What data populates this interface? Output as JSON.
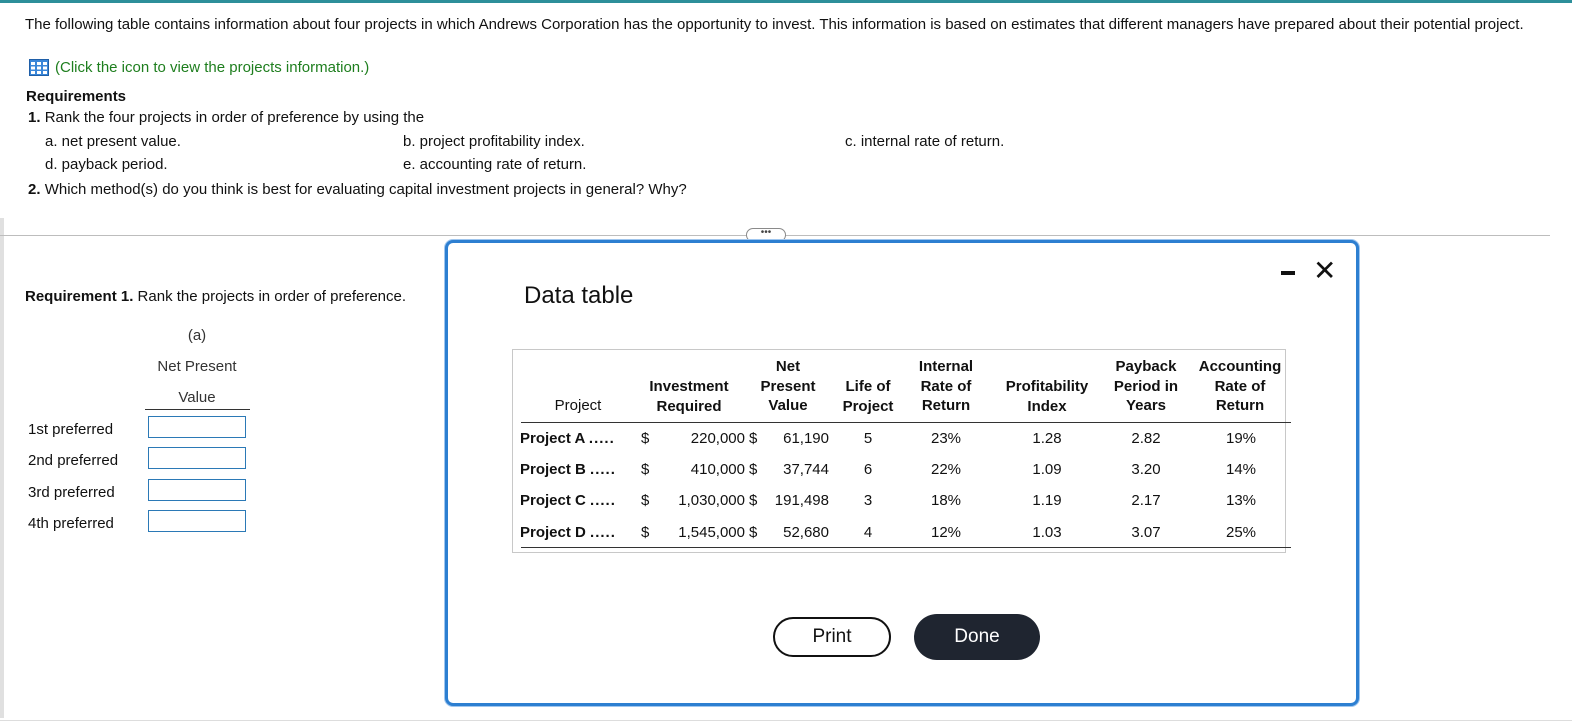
{
  "intro": "The following table contains information about four projects in which Andrews Corporation has the opportunity to invest. This information is based on estimates that different managers have prepared about their potential project.",
  "icon_link": "(Click the icon to view the projects information.)",
  "requirements": {
    "heading": "Requirements",
    "q1_num": "1.",
    "q1_text": "Rank the four projects in order of preference by using the",
    "a": "a.  net present value.",
    "b": "b.  project profitability index.",
    "c": "c.  internal rate of return.",
    "d": "d.  payback period.",
    "e": "e.  accounting rate of return.",
    "q2_num": "2.",
    "q2_text": "Which method(s) do you think is best for evaluating capital investment projects in general? Why?"
  },
  "expand_dots": "•••",
  "req1": {
    "label": "Requirement 1.",
    "text": "Rank the projects in order of preference.",
    "col_letter": "(a)",
    "col_title_1": "Net Present",
    "col_title_2": "Value",
    "ranks": [
      "1st preferred",
      "2nd preferred",
      "3rd preferred",
      "4th preferred"
    ]
  },
  "modal": {
    "title": "Data table",
    "headers": {
      "project": "Project",
      "investment": "Investment\nRequired",
      "npv": "Net\nPresent\nValue",
      "life": "Life of\nProject",
      "irr": "Internal\nRate of\nReturn",
      "pi": "Profitability\nIndex",
      "payback": "Payback\nPeriod in\nYears",
      "arr": "Accounting\nRate of\nReturn"
    },
    "rows": [
      {
        "name": "Project A",
        "dots": ".....",
        "cur1": "$",
        "investment": "220,000",
        "cur2": "$",
        "npv": "61,190",
        "life": "5",
        "irr": "23%",
        "pi": "1.28",
        "payback": "2.82",
        "arr": "19%"
      },
      {
        "name": "Project B",
        "dots": ".....",
        "cur1": "$",
        "investment": "410,000",
        "cur2": "$",
        "npv": "37,744",
        "life": "6",
        "irr": "22%",
        "pi": "1.09",
        "payback": "3.20",
        "arr": "14%"
      },
      {
        "name": "Project C",
        "dots": ".....",
        "cur1": "$",
        "investment": "1,030,000",
        "cur2": "$",
        "npv": "191,498",
        "life": "3",
        "irr": "18%",
        "pi": "1.19",
        "payback": "2.17",
        "arr": "13%"
      },
      {
        "name": "Project D",
        "dots": ".....",
        "cur1": "$",
        "investment": "1,545,000",
        "cur2": "$",
        "npv": "52,680",
        "life": "4",
        "irr": "12%",
        "pi": "1.03",
        "payback": "3.07",
        "arr": "25%"
      }
    ],
    "print_label": "Print",
    "done_label": "Done",
    "close_glyph": "✕"
  }
}
